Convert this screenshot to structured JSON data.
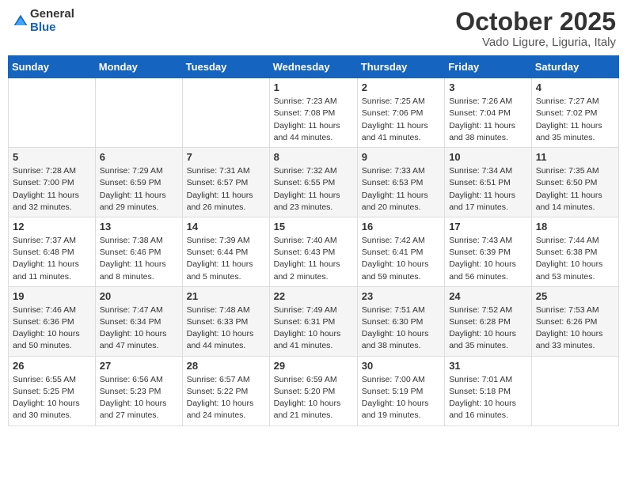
{
  "logo": {
    "general": "General",
    "blue": "Blue"
  },
  "header": {
    "month": "October 2025",
    "location": "Vado Ligure, Liguria, Italy"
  },
  "weekdays": [
    "Sunday",
    "Monday",
    "Tuesday",
    "Wednesday",
    "Thursday",
    "Friday",
    "Saturday"
  ],
  "weeks": [
    [
      {
        "day": "",
        "sunrise": "",
        "sunset": "",
        "daylight": ""
      },
      {
        "day": "",
        "sunrise": "",
        "sunset": "",
        "daylight": ""
      },
      {
        "day": "",
        "sunrise": "",
        "sunset": "",
        "daylight": ""
      },
      {
        "day": "1",
        "sunrise": "Sunrise: 7:23 AM",
        "sunset": "Sunset: 7:08 PM",
        "daylight": "Daylight: 11 hours and 44 minutes."
      },
      {
        "day": "2",
        "sunrise": "Sunrise: 7:25 AM",
        "sunset": "Sunset: 7:06 PM",
        "daylight": "Daylight: 11 hours and 41 minutes."
      },
      {
        "day": "3",
        "sunrise": "Sunrise: 7:26 AM",
        "sunset": "Sunset: 7:04 PM",
        "daylight": "Daylight: 11 hours and 38 minutes."
      },
      {
        "day": "4",
        "sunrise": "Sunrise: 7:27 AM",
        "sunset": "Sunset: 7:02 PM",
        "daylight": "Daylight: 11 hours and 35 minutes."
      }
    ],
    [
      {
        "day": "5",
        "sunrise": "Sunrise: 7:28 AM",
        "sunset": "Sunset: 7:00 PM",
        "daylight": "Daylight: 11 hours and 32 minutes."
      },
      {
        "day": "6",
        "sunrise": "Sunrise: 7:29 AM",
        "sunset": "Sunset: 6:59 PM",
        "daylight": "Daylight: 11 hours and 29 minutes."
      },
      {
        "day": "7",
        "sunrise": "Sunrise: 7:31 AM",
        "sunset": "Sunset: 6:57 PM",
        "daylight": "Daylight: 11 hours and 26 minutes."
      },
      {
        "day": "8",
        "sunrise": "Sunrise: 7:32 AM",
        "sunset": "Sunset: 6:55 PM",
        "daylight": "Daylight: 11 hours and 23 minutes."
      },
      {
        "day": "9",
        "sunrise": "Sunrise: 7:33 AM",
        "sunset": "Sunset: 6:53 PM",
        "daylight": "Daylight: 11 hours and 20 minutes."
      },
      {
        "day": "10",
        "sunrise": "Sunrise: 7:34 AM",
        "sunset": "Sunset: 6:51 PM",
        "daylight": "Daylight: 11 hours and 17 minutes."
      },
      {
        "day": "11",
        "sunrise": "Sunrise: 7:35 AM",
        "sunset": "Sunset: 6:50 PM",
        "daylight": "Daylight: 11 hours and 14 minutes."
      }
    ],
    [
      {
        "day": "12",
        "sunrise": "Sunrise: 7:37 AM",
        "sunset": "Sunset: 6:48 PM",
        "daylight": "Daylight: 11 hours and 11 minutes."
      },
      {
        "day": "13",
        "sunrise": "Sunrise: 7:38 AM",
        "sunset": "Sunset: 6:46 PM",
        "daylight": "Daylight: 11 hours and 8 minutes."
      },
      {
        "day": "14",
        "sunrise": "Sunrise: 7:39 AM",
        "sunset": "Sunset: 6:44 PM",
        "daylight": "Daylight: 11 hours and 5 minutes."
      },
      {
        "day": "15",
        "sunrise": "Sunrise: 7:40 AM",
        "sunset": "Sunset: 6:43 PM",
        "daylight": "Daylight: 11 hours and 2 minutes."
      },
      {
        "day": "16",
        "sunrise": "Sunrise: 7:42 AM",
        "sunset": "Sunset: 6:41 PM",
        "daylight": "Daylight: 10 hours and 59 minutes."
      },
      {
        "day": "17",
        "sunrise": "Sunrise: 7:43 AM",
        "sunset": "Sunset: 6:39 PM",
        "daylight": "Daylight: 10 hours and 56 minutes."
      },
      {
        "day": "18",
        "sunrise": "Sunrise: 7:44 AM",
        "sunset": "Sunset: 6:38 PM",
        "daylight": "Daylight: 10 hours and 53 minutes."
      }
    ],
    [
      {
        "day": "19",
        "sunrise": "Sunrise: 7:46 AM",
        "sunset": "Sunset: 6:36 PM",
        "daylight": "Daylight: 10 hours and 50 minutes."
      },
      {
        "day": "20",
        "sunrise": "Sunrise: 7:47 AM",
        "sunset": "Sunset: 6:34 PM",
        "daylight": "Daylight: 10 hours and 47 minutes."
      },
      {
        "day": "21",
        "sunrise": "Sunrise: 7:48 AM",
        "sunset": "Sunset: 6:33 PM",
        "daylight": "Daylight: 10 hours and 44 minutes."
      },
      {
        "day": "22",
        "sunrise": "Sunrise: 7:49 AM",
        "sunset": "Sunset: 6:31 PM",
        "daylight": "Daylight: 10 hours and 41 minutes."
      },
      {
        "day": "23",
        "sunrise": "Sunrise: 7:51 AM",
        "sunset": "Sunset: 6:30 PM",
        "daylight": "Daylight: 10 hours and 38 minutes."
      },
      {
        "day": "24",
        "sunrise": "Sunrise: 7:52 AM",
        "sunset": "Sunset: 6:28 PM",
        "daylight": "Daylight: 10 hours and 35 minutes."
      },
      {
        "day": "25",
        "sunrise": "Sunrise: 7:53 AM",
        "sunset": "Sunset: 6:26 PM",
        "daylight": "Daylight: 10 hours and 33 minutes."
      }
    ],
    [
      {
        "day": "26",
        "sunrise": "Sunrise: 6:55 AM",
        "sunset": "Sunset: 5:25 PM",
        "daylight": "Daylight: 10 hours and 30 minutes."
      },
      {
        "day": "27",
        "sunrise": "Sunrise: 6:56 AM",
        "sunset": "Sunset: 5:23 PM",
        "daylight": "Daylight: 10 hours and 27 minutes."
      },
      {
        "day": "28",
        "sunrise": "Sunrise: 6:57 AM",
        "sunset": "Sunset: 5:22 PM",
        "daylight": "Daylight: 10 hours and 24 minutes."
      },
      {
        "day": "29",
        "sunrise": "Sunrise: 6:59 AM",
        "sunset": "Sunset: 5:20 PM",
        "daylight": "Daylight: 10 hours and 21 minutes."
      },
      {
        "day": "30",
        "sunrise": "Sunrise: 7:00 AM",
        "sunset": "Sunset: 5:19 PM",
        "daylight": "Daylight: 10 hours and 19 minutes."
      },
      {
        "day": "31",
        "sunrise": "Sunrise: 7:01 AM",
        "sunset": "Sunset: 5:18 PM",
        "daylight": "Daylight: 10 hours and 16 minutes."
      },
      {
        "day": "",
        "sunrise": "",
        "sunset": "",
        "daylight": ""
      }
    ]
  ]
}
